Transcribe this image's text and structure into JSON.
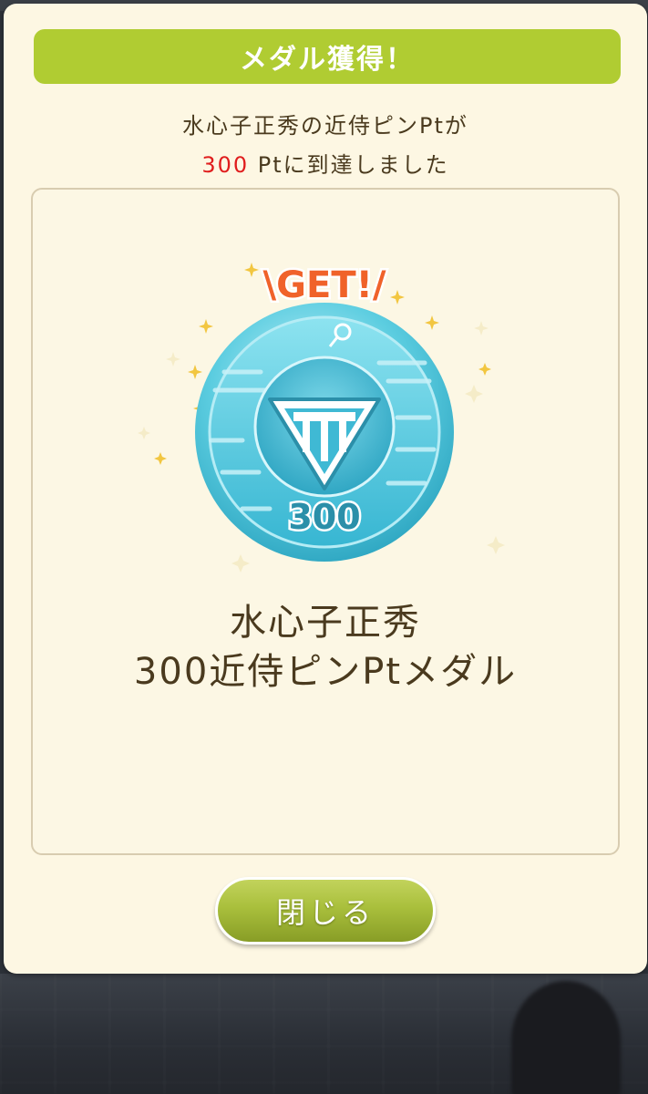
{
  "dialog": {
    "title": "メダル獲得！",
    "message_line1": "水心子正秀の近侍ピンPtが",
    "message_points": "300",
    "message_line2_rest": " Ptに到達しました",
    "medal": {
      "get_label": "\\GET!/",
      "value_label": "300",
      "name_line1": "水心子正秀",
      "name_line2": "300近侍ピンPtメダル",
      "icon": "triangle-emblem-icon"
    },
    "close_label": "閉じる"
  },
  "colors": {
    "title_bar": "#b0cc32",
    "dialog_bg": "#fdf7e3",
    "text": "#4a3a1e",
    "points_red": "#e01d1d",
    "medal_teal": "#5ccde0",
    "get_orange": "#f0622a"
  }
}
